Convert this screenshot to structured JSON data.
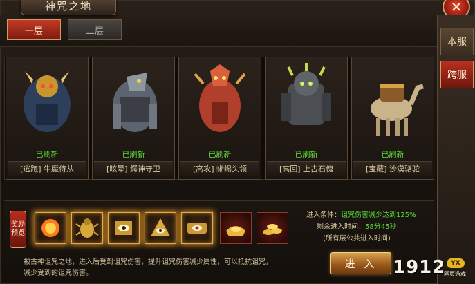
{
  "window": {
    "title": "神咒之地",
    "close_icon": "close-icon"
  },
  "floor_tabs": [
    {
      "label": "一层",
      "active": true
    },
    {
      "label": "二层",
      "active": false
    }
  ],
  "server_tabs": [
    {
      "label": "本服",
      "active": false
    },
    {
      "label": "跨服",
      "active": true
    }
  ],
  "bosses": [
    {
      "status": "已刷新",
      "name": "[逃跑] 牛魔侍从",
      "icon": "minotaur-guard-icon"
    },
    {
      "status": "已刷新",
      "name": "[眩晕] 鳄神守卫",
      "icon": "crocodile-guard-icon"
    },
    {
      "status": "已刷新",
      "name": "[高攻] 蜥蜴头领",
      "icon": "lizard-chief-icon"
    },
    {
      "status": "已刷新",
      "name": "[高回] 上古石傀",
      "icon": "stone-golem-icon"
    },
    {
      "status": "已刷新",
      "name": "[宝藏] 沙漠骆驼",
      "icon": "treasure-camel-icon"
    }
  ],
  "rewards": {
    "badge_top": "奖励",
    "badge_bottom": "预览",
    "items": [
      {
        "icon": "fire-orb-icon",
        "style": "glow"
      },
      {
        "icon": "scarab-icon",
        "style": "glow"
      },
      {
        "icon": "eye-rune-icon",
        "style": "glow"
      },
      {
        "icon": "pyramid-eye-icon",
        "style": "glow"
      },
      {
        "icon": "eye-rune-scroll-icon",
        "style": "glow"
      },
      {
        "icon": "gold-ingot-icon",
        "style": "red"
      },
      {
        "icon": "gold-pile-icon",
        "style": "red"
      }
    ]
  },
  "conditions": {
    "req_label": "进入条件：",
    "req_value": "诅咒伤害减少达到125%",
    "time_label": "剩余进入时间：",
    "time_value": "58分45秒",
    "note": "(所有层公共进入时间)"
  },
  "description": "被古神诅咒之地，进入后受到诅咒伤害，提升诅咒伤害减少属性，可以抵抗诅咒，减少受到的诅咒伤害。",
  "enter_label": "进 入",
  "watermark": {
    "number": "1912",
    "badge": "YX",
    "sub": "网页游戏"
  }
}
